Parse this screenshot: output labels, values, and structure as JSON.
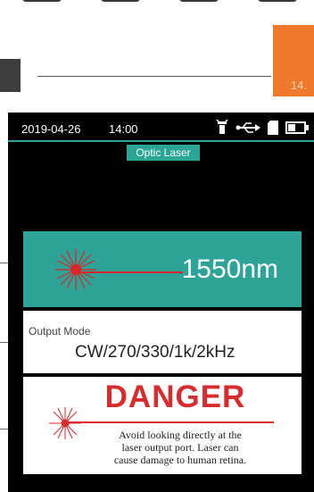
{
  "page": {
    "number": "14."
  },
  "status": {
    "date": "2019-04-26",
    "time": "14:00"
  },
  "screen": {
    "title": "Optic Laser"
  },
  "laser": {
    "wavelength": "1550nm"
  },
  "mode": {
    "label": "Output Mode",
    "value": "CW/270/330/1k/2kHz"
  },
  "danger": {
    "title": "DANGER",
    "lines": [
      "Avoid looking directly at the",
      "laser output port. Laser can",
      "cause damage to human retina."
    ]
  },
  "icons": [
    "flashlight-icon",
    "usb-icon",
    "sd-card-icon",
    "battery-icon"
  ],
  "colors": {
    "teal": "#2da497",
    "danger": "#d82b2d",
    "tab": "#ef7a2b"
  }
}
